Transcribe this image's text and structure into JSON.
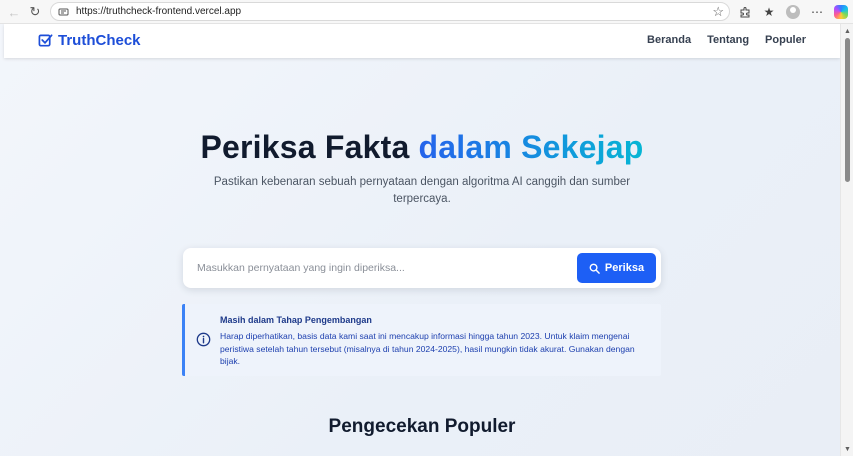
{
  "browser": {
    "url": "https://truthcheck-frontend.vercel.app",
    "icons": [
      "back-icon",
      "refresh-icon",
      "site-info-icon",
      "favorite-star-icon",
      "extensions-icon",
      "favorites-icon",
      "profile-avatar",
      "menu-dots-icon",
      "copilot-icon"
    ]
  },
  "site": {
    "brand": "TruthCheck",
    "nav": [
      "Beranda",
      "Tentang",
      "Populer"
    ],
    "accent_color": "#1d4ed8"
  },
  "hero": {
    "title_plain": "Periksa Fakta ",
    "title_highlight": "dalam Sekejap",
    "subtitle": "Pastikan kebenaran sebuah pernyataan dengan algoritma AI canggih dan sumber terpercaya."
  },
  "search": {
    "placeholder": "Masukkan pernyataan yang ingin diperiksa...",
    "value": "",
    "button_label": "Periksa",
    "button_color": "#1d5ff5"
  },
  "notice": {
    "title": "Masih dalam Tahap Pengembangan",
    "body": "Harap diperhatikan, basis data kami saat ini mencakup informasi hingga tahun 2023. Untuk klaim mengenai peristiwa setelah tahun tersebut (misalnya di tahun 2024-2025), hasil mungkin tidak akurat. Gunakan dengan bijak."
  },
  "popular": {
    "title": "Pengecekan Populer"
  }
}
